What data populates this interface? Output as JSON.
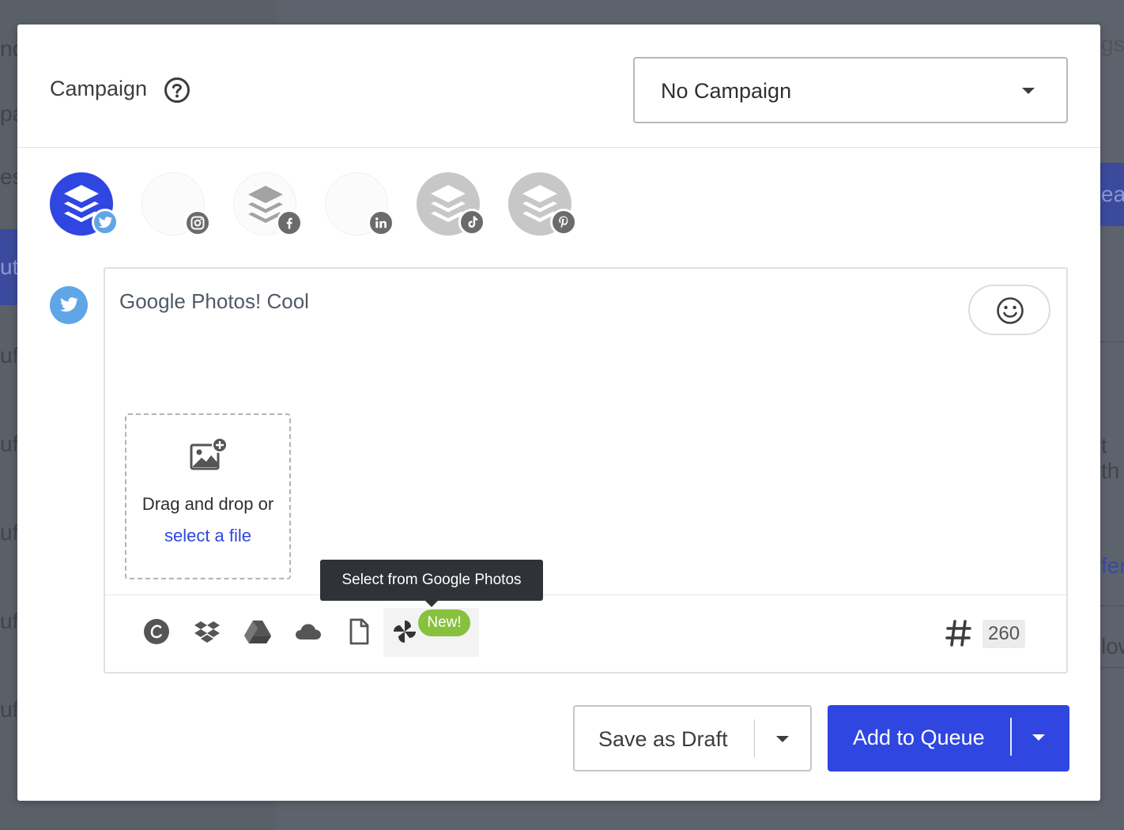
{
  "background": {
    "fragments": [
      "nd",
      "pa",
      "es",
      "ut",
      "uf",
      "uf",
      "uf",
      "uf",
      "uf",
      "gs",
      "ea",
      "t th",
      "fer",
      "low"
    ]
  },
  "campaign": {
    "label": "Campaign",
    "help_icon": "question-circle-icon",
    "select_value": "No Campaign"
  },
  "profiles": [
    {
      "network": "twitter",
      "state": "selected",
      "badge_icon": "twitter-icon"
    },
    {
      "network": "instagram",
      "state": "unselected",
      "badge_icon": "instagram-icon"
    },
    {
      "network": "facebook",
      "state": "unselected",
      "badge_icon": "facebook-icon"
    },
    {
      "network": "linkedin",
      "state": "unselected",
      "badge_icon": "linkedin-icon"
    },
    {
      "network": "tiktok",
      "state": "disabled",
      "badge_icon": "tiktok-icon"
    },
    {
      "network": "pinterest",
      "state": "disabled",
      "badge_icon": "pinterest-icon"
    }
  ],
  "composer": {
    "network_icon": "twitter-icon",
    "text": "Google Photos! Cool",
    "emoji_icon": "smiley-icon",
    "dropzone": {
      "icon": "add-image-icon",
      "text": "Drag and drop or",
      "link": "select a file"
    },
    "toolbar": {
      "tools": [
        "canva-icon",
        "dropbox-icon",
        "google-drive-icon",
        "onedrive-icon",
        "file-icon",
        "google-photos-icon"
      ],
      "new_badge": "New!",
      "hashtag_icon": "hashtag-icon",
      "char_count": "260"
    }
  },
  "tooltip": "Select from Google Photos",
  "footer": {
    "draft_label": "Save as Draft",
    "queue_label": "Add to Queue"
  },
  "colors": {
    "primary": "#2f46e0",
    "twitter": "#5fa5e8",
    "new_badge": "#87c13d",
    "tooltip": "#2f3338"
  }
}
